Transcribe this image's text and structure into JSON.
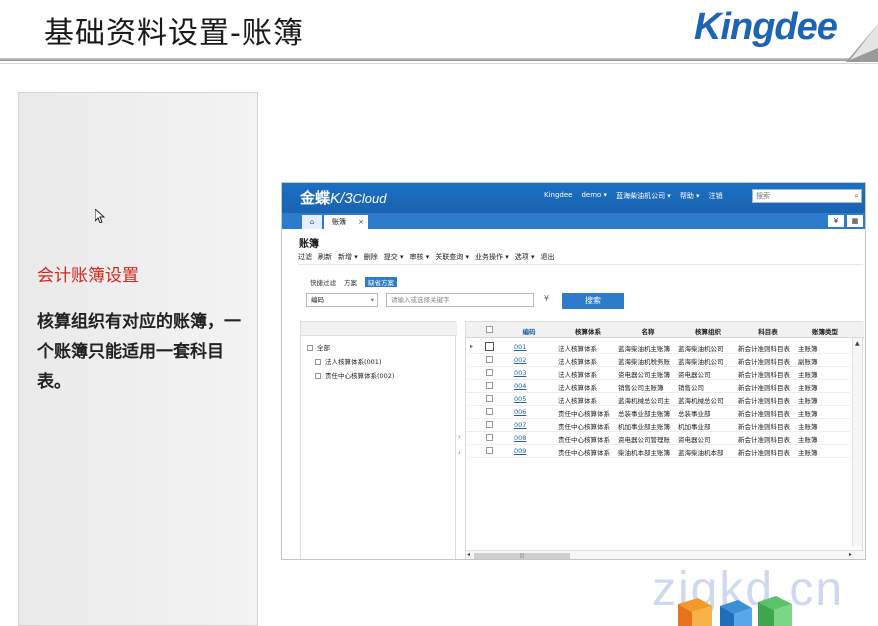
{
  "slide": {
    "title": "基础资料设置-账簿",
    "logo": "Kingdee",
    "side_heading": "会计账簿设置",
    "side_text": "核算组织有对应的账簿，一个账簿只能适用一套科目表。",
    "watermark": "zigkd.cn"
  },
  "app": {
    "brand_main": "金蝶",
    "brand_k3": "K/3",
    "brand_cloud": "Cloud",
    "top_links": [
      "Kingdee",
      "demo ▾",
      "蓝海柴油机公司 ▾",
      "帮助 ▾",
      "注销"
    ],
    "search_placeholder": "搜索",
    "home_tab": "⌂",
    "active_tab": "账簿",
    "tab_tools": [
      "¥",
      "▦"
    ],
    "page_name": "账簿",
    "toolbar": [
      "过滤",
      "刷新",
      "新增 ▾",
      "删除",
      "提交 ▾",
      "审核 ▾",
      "关联查询 ▾",
      "业务操作 ▾",
      "选项 ▾",
      "退出"
    ],
    "filter_tabs": [
      "快捷过滤",
      "方案",
      "缺省方案"
    ],
    "field_select": "编码",
    "field_input_placeholder": "请输入或选择关键字",
    "search_button": "搜索",
    "tree": [
      {
        "label": "全部",
        "level": 0
      },
      {
        "label": "法人核算体系(001)",
        "level": 1
      },
      {
        "label": "责任中心核算体系(002)",
        "level": 1
      }
    ],
    "grid": {
      "headers": [
        "编码",
        "核算体系",
        "名称",
        "核算组织",
        "科目表",
        "账簿类型"
      ],
      "rows": [
        [
          "001",
          "法人核算体系",
          "蓝海柴油机主账簿",
          "蓝海柴油机公司",
          "新会计准则科目表",
          "主账簿"
        ],
        [
          "002",
          "法人核算体系",
          "蓝海柴油机税务账",
          "蓝海柴油机公司",
          "新会计准则科目表",
          "副账簿"
        ],
        [
          "003",
          "法人核算体系",
          "资电器公司主账簿",
          "资电器公司",
          "新会计准则科目表",
          "主账簿"
        ],
        [
          "004",
          "法人核算体系",
          "销售公司主账簿",
          "销售公司",
          "新会计准则科目表",
          "主账簿"
        ],
        [
          "005",
          "法人核算体系",
          "蓝海机械总公司主",
          "蓝海机械总公司",
          "新会计准则科目表",
          "主账簿"
        ],
        [
          "006",
          "责任中心核算体系",
          "总装事业部主账簿",
          "总装事业部",
          "新会计准则科目表",
          "主账簿"
        ],
        [
          "007",
          "责任中心核算体系",
          "机加事业部主账簿",
          "机加事业部",
          "新会计准则科目表",
          "主账簿"
        ],
        [
          "008",
          "责任中心核算体系",
          "资电器公司管理账",
          "资电器公司",
          "新会计准则科目表",
          "主账簿"
        ],
        [
          "009",
          "责任中心核算体系",
          "柴油机本部主账簿",
          "蓝海柴油机本部",
          "新会计准则科目表",
          "主账簿"
        ]
      ],
      "scroll_thumb_label": "|||"
    }
  }
}
